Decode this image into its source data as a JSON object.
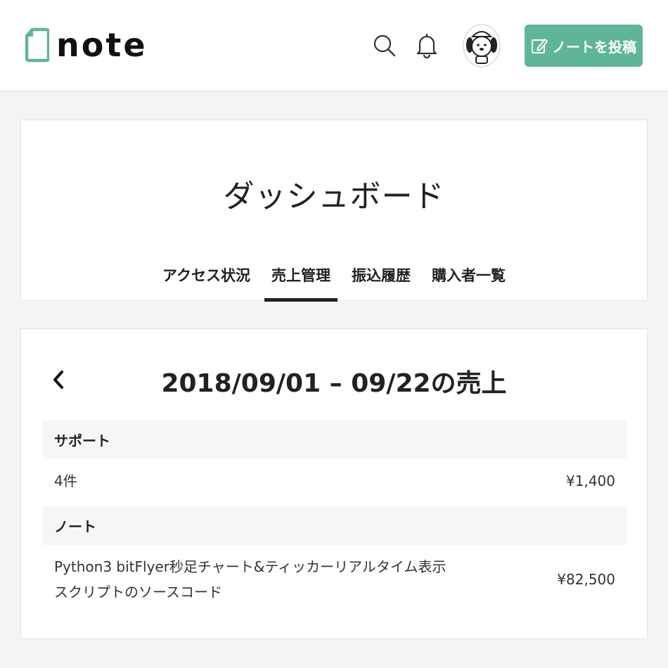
{
  "header": {
    "logo_text": "note",
    "post_button_label": "ノートを投稿",
    "brand_color": "#5fb59a"
  },
  "dashboard": {
    "title": "ダッシュボード",
    "tabs": [
      {
        "label": "アクセス状況",
        "active": false
      },
      {
        "label": "売上管理",
        "active": true
      },
      {
        "label": "振込履歴",
        "active": false
      },
      {
        "label": "購入者一覧",
        "active": false
      }
    ]
  },
  "sales": {
    "period_title": "2018/09/01 – 09/22の売上",
    "sections": [
      {
        "heading": "サポート",
        "rows": [
          {
            "name": "4件",
            "amount": "¥1,400"
          }
        ]
      },
      {
        "heading": "ノート",
        "rows": [
          {
            "name": "Python3 bitFlyer秒足チャート&ティッカーリアルタイム表示スクリプトのソースコード",
            "amount": "¥82,500"
          }
        ]
      }
    ]
  },
  "icons": [
    "note-logo-icon",
    "search-icon",
    "bell-icon",
    "avatar",
    "pencil-icon",
    "chevron-left-icon"
  ]
}
